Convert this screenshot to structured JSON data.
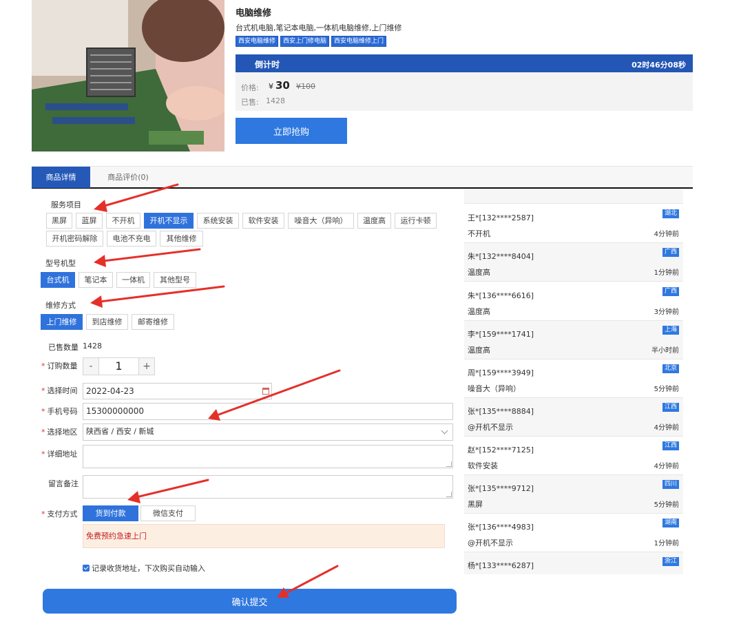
{
  "product": {
    "title": "电脑维修",
    "desc": "台式机电脑,笔记本电脑,一体机电脑维修,上门维修",
    "tags": [
      "西安电脑维修",
      "西安上门修电脑",
      "西安电脑维修上门"
    ],
    "countdown_label": "倒计时",
    "countdown_time": "02时46分08秒",
    "price_label": "价格:",
    "currency": "¥",
    "price": "30",
    "original_price": "¥100",
    "sold_label": "已售:",
    "sold": "1428",
    "buy_label": "立即抢购"
  },
  "tabs": {
    "detail": "商品详情",
    "review": "商品评价(0)"
  },
  "form": {
    "service_title": "服务项目",
    "services": [
      "黑屏",
      "蓝屏",
      "不开机",
      "开机不显示",
      "系统安装",
      "软件安装",
      "噪音大（异响）",
      "温度高",
      "运行卡顿",
      "开机密码解除",
      "电池不充电",
      "其他维修"
    ],
    "service_selected": "开机不显示",
    "model_title": "型号机型",
    "models": [
      "台式机",
      "笔记本",
      "一体机",
      "其他型号"
    ],
    "model_selected": "台式机",
    "method_title": "维修方式",
    "methods": [
      "上门维修",
      "到店维修",
      "邮寄维修"
    ],
    "method_selected": "上门维修",
    "sold_qty_label": "已售数量",
    "sold_qty": "1428",
    "qty_label": "订购数量",
    "qty": "1",
    "date_label": "选择时间",
    "date": "2022-04-23",
    "phone_label": "手机号码",
    "phone": "15300000000",
    "region_label": "选择地区",
    "region": "陕西省 / 西安 / 新城",
    "address_label": "详细地址",
    "remark_label": "留言备注",
    "pay_label": "支付方式",
    "pay_options": [
      "货到付款",
      "微信支付"
    ],
    "pay_selected": "货到付款",
    "notice": "免费预约急速上门",
    "remember": "记录收货地址，下次购买自动输入",
    "submit": "确认提交"
  },
  "orders": [
    {
      "name": "王*[132****2587]",
      "region": "湖北",
      "service": "不开机",
      "time": "4分钟前"
    },
    {
      "name": "朱*[132****8404]",
      "region": "广西",
      "service": "温度高",
      "time": "1分钟前"
    },
    {
      "name": "朱*[136****6616]",
      "region": "广西",
      "service": "温度高",
      "time": "3分钟前"
    },
    {
      "name": "李*[159****1741]",
      "region": "上海",
      "service": "温度高",
      "time": "半小时前"
    },
    {
      "name": "周*[159****3949]",
      "region": "北京",
      "service": "噪音大（异响）",
      "time": "5分钟前"
    },
    {
      "name": "张*[135****8884]",
      "region": "江西",
      "service": "@开机不显示",
      "time": "4分钟前"
    },
    {
      "name": "赵*[152****7125]",
      "region": "江西",
      "service": "软件安装",
      "time": "4分钟前"
    },
    {
      "name": "张*[135****9712]",
      "region": "四川",
      "service": "黑屏",
      "time": "5分钟前"
    },
    {
      "name": "张*[136****4983]",
      "region": "湖南",
      "service": "@开机不显示",
      "time": "1分钟前"
    },
    {
      "name": "杨*[133****6287]",
      "region": "浙江",
      "service": "",
      "time": ""
    }
  ],
  "colors": {
    "primary": "#2f78e0",
    "header_blue": "#2356b5",
    "arrow_red": "#e5302a"
  }
}
